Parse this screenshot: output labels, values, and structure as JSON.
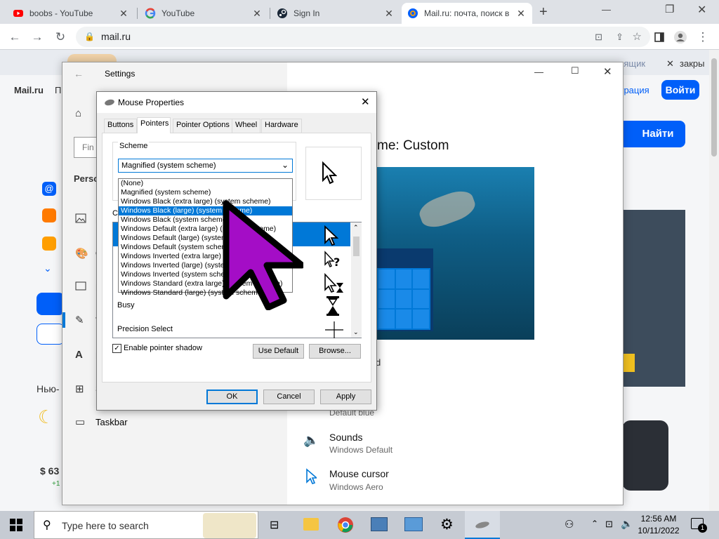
{
  "browser": {
    "tabs": [
      {
        "title": "boobs - YouTube",
        "icon": "youtube-icon",
        "active": false
      },
      {
        "title": "YouTube",
        "icon": "google-icon",
        "active": false
      },
      {
        "title": "Sign In",
        "icon": "steam-icon",
        "active": false
      },
      {
        "title": "Mail.ru: почта, поиск в",
        "icon": "mailru-icon",
        "active": true
      }
    ],
    "url": "mail.ru"
  },
  "webpage": {
    "brand": "Mail.ru",
    "search_button": "Найти",
    "login_button": "Войти",
    "register_link": "страция",
    "create_mailbox": "ть ящик",
    "close_text": "закры",
    "search_placeholder": "Fin",
    "section_news": "Нью-",
    "currency": "$ 63",
    "currency_change": "+1"
  },
  "settings": {
    "title": "Settings",
    "person_label": "Perso",
    "theme_heading": "me: Custom",
    "taskbar_label": "Taskbar",
    "items": [
      {
        "title": "Default blue",
        "subtitle": ""
      },
      {
        "title": "Sounds",
        "subtitle": "Windows Default"
      },
      {
        "title": "Mouse cursor",
        "subtitle": "Windows Aero"
      }
    ],
    "partial_d": "d"
  },
  "mouse_properties": {
    "title": "Mouse Properties",
    "tabs": [
      "Buttons",
      "Pointers",
      "Pointer Options",
      "Wheel",
      "Hardware"
    ],
    "selected_tab": "Pointers",
    "scheme_label": "Scheme",
    "scheme_value": "Magnified (system scheme)",
    "customize_label": "Cu",
    "scheme_options": [
      "(None)",
      "Magnified (system scheme)",
      "Windows Black (extra large) (system scheme)",
      "Windows Black (large) (system scheme)",
      "Windows Black (system scheme)",
      "Windows Default (extra large) (system scheme)",
      "Windows Default (large) (system scheme)",
      "Windows Default (system scheme)",
      "Windows Inverted (extra large) (system scheme)",
      "Windows Inverted (large) (system scheme)",
      "Windows Inverted (system scheme)",
      "Windows Standard (extra large) (system scheme)",
      "Windows Standard (large) (system scheme)"
    ],
    "highlighted_option": "Windows Black (large) (system scheme)",
    "pointer_rows": [
      "Busy",
      "Precision Select"
    ],
    "enable_shadow": "Enable pointer shadow",
    "use_default": "Use Default",
    "browse": "Browse...",
    "ok": "OK",
    "cancel": "Cancel",
    "apply": "Apply"
  },
  "taskbar": {
    "search_placeholder": "Type here to search",
    "time": "12:56 AM",
    "date": "10/11/2022",
    "notifications": "1"
  }
}
